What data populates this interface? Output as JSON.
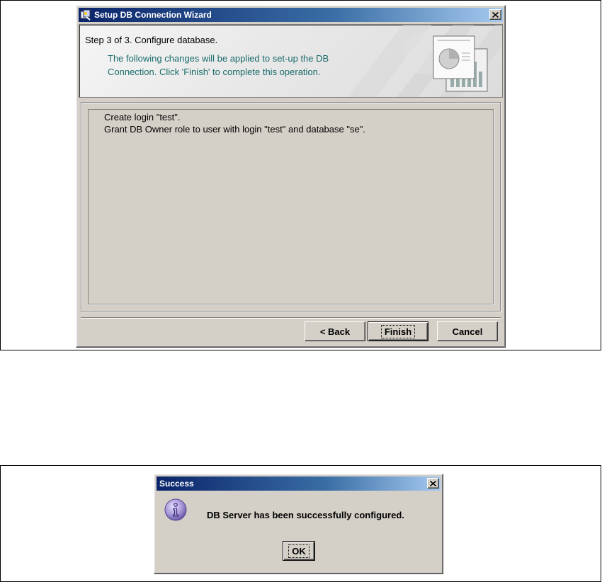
{
  "wizard": {
    "title": "Setup DB Connection Wizard",
    "step_title": "Step 3 of 3. Configure database.",
    "step_description": "The following changes will be applied to set-up the DB Connection. Click 'Finish' to complete this operation.",
    "changes": [
      "Create login \"test\".",
      "Grant DB Owner role to user with login \"test\" and database \"se\"."
    ],
    "buttons": {
      "back": "< Back",
      "finish": "Finish",
      "cancel": "Cancel"
    }
  },
  "success_dialog": {
    "title": "Success",
    "message": "DB Server has been successfully configured.",
    "ok": "OK"
  },
  "icons": {
    "wizard_app": "wizard-app-icon",
    "close": "close-icon",
    "header_graphic": "chart-document-icon",
    "info": "info-icon"
  },
  "colors": {
    "title_bar_start": "#0a246a",
    "title_bar_end": "#a6caf0",
    "description_text": "#1a6b6b",
    "window_face": "#d4d0c8"
  }
}
